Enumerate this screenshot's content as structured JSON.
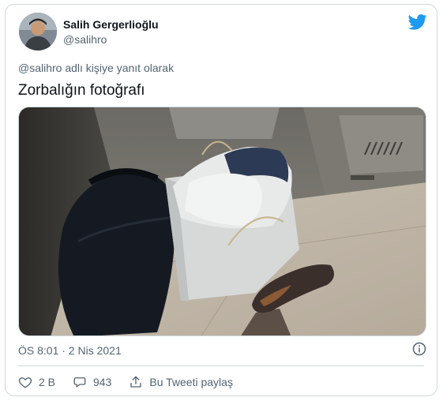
{
  "tweet": {
    "author_name": "Salih Gergerlioğlu",
    "author_handle": "@salihro",
    "reply_context": "@salihro adlı kişiye yanıt olarak",
    "text": "Zorbalığın fotoğrafı",
    "timestamp": "ÖS 8:01 · 2 Nis 2021",
    "icons": {
      "brand": "twitter-bird-icon",
      "info": "info-icon",
      "like": "heart-icon",
      "reply": "comment-icon",
      "share": "share-icon"
    },
    "colors": {
      "brand": "#1d9bf0",
      "secondary_text": "#536471",
      "border": "#cfd9de"
    }
  },
  "actions": {
    "like_count": "2 B",
    "reply_count": "943",
    "share_label": "Bu Tweeti paylaş"
  }
}
